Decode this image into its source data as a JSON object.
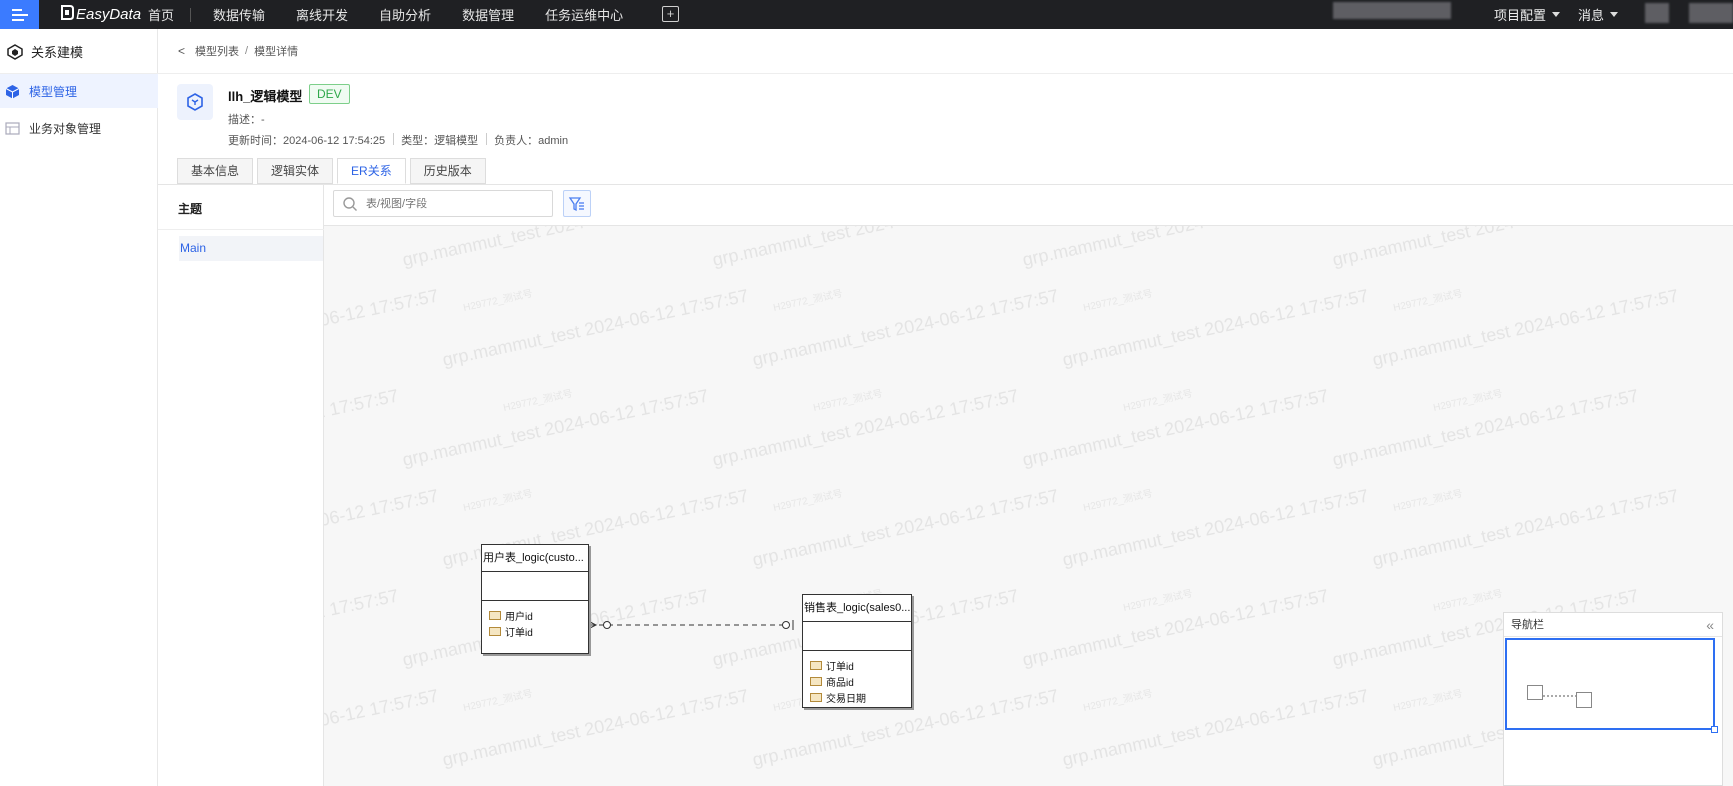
{
  "topbar": {
    "logo": "EasyData",
    "nav": [
      "首页",
      "数据传输",
      "离线开发",
      "自助分析",
      "数据管理",
      "任务运维中心"
    ],
    "project_config": "项目配置",
    "messages": "消息"
  },
  "sidebar": {
    "title": "关系建模",
    "items": [
      {
        "label": "模型管理",
        "active": true
      },
      {
        "label": "业务对象管理",
        "active": false
      }
    ]
  },
  "breadcrumb": {
    "parent": "模型列表",
    "current": "模型详情"
  },
  "model": {
    "name": "llh_逻辑模型",
    "env_badge": "DEV",
    "description": "描述：-",
    "updated": "更新时间：2024-06-12 17:54:25",
    "type": "类型：逻辑模型",
    "owner": "负责人：admin"
  },
  "tabs": [
    {
      "label": "基本信息",
      "active": false
    },
    {
      "label": "逻辑实体",
      "active": false
    },
    {
      "label": "ER关系",
      "active": true
    },
    {
      "label": "历史版本",
      "active": false
    }
  ],
  "theme_panel": {
    "title": "主题",
    "items": [
      "Main"
    ]
  },
  "search": {
    "placeholder": "表/视图/字段"
  },
  "entities": [
    {
      "title": "用户表_logic(custo...",
      "fields": [
        "用户id",
        "订单id"
      ]
    },
    {
      "title": "销售表_logic(sales0...",
      "fields": [
        "订单id",
        "商品id",
        "交易日期"
      ]
    }
  ],
  "nav_panel": {
    "title": "导航栏"
  },
  "watermark": {
    "main": "grp.mammut_test 2024-06-12 17:57:57",
    "small": "H29772_测试号"
  },
  "colors": {
    "accent": "#2e64e6",
    "topbar": "#1f2023",
    "dev_badge": "#2fa84a"
  }
}
